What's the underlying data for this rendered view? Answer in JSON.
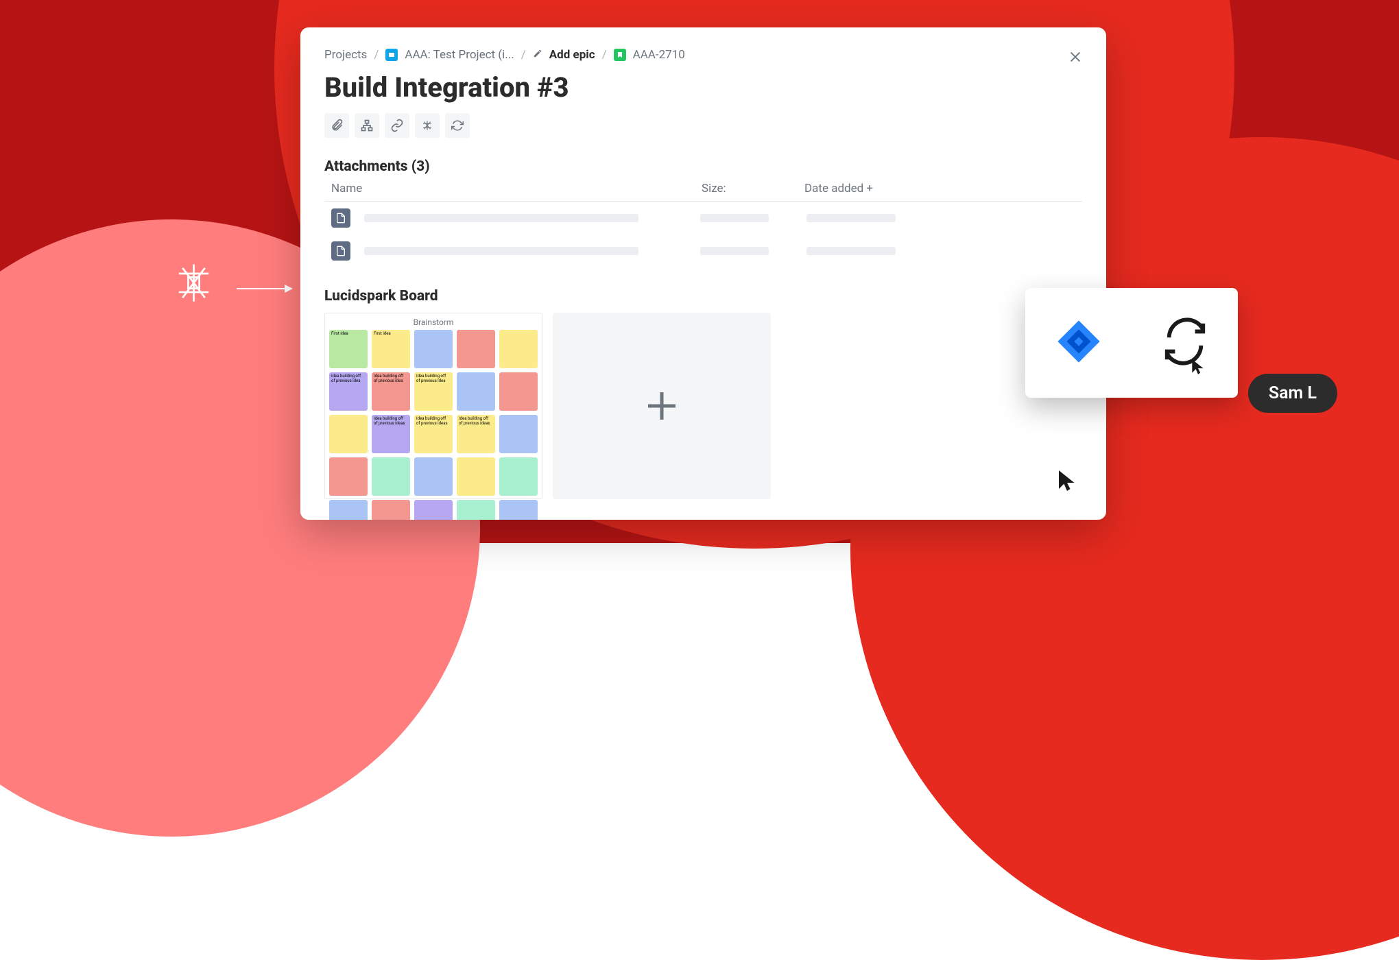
{
  "breadcrumb": {
    "projects": "Projects",
    "project_name": "AAA: Test Project (i...",
    "add_epic": "Add epic",
    "ticket": "AAA-2710"
  },
  "issue": {
    "title": "Build Integration #3"
  },
  "attachments": {
    "heading": "Attachments (3)",
    "columns": {
      "name": "Name",
      "size": "Size:",
      "date": "Date added +"
    }
  },
  "lucidspark": {
    "heading": "Lucidspark Board",
    "board_title": "Brainstorm",
    "stickies": [
      {
        "text": "First idea",
        "color": "#b9e8a3"
      },
      {
        "text": "First idea",
        "color": "#fceb8a"
      },
      {
        "text": "",
        "color": "#a9c4f5"
      },
      {
        "text": "",
        "color": "#f29891"
      },
      {
        "text": "",
        "color": "#fceb8a"
      },
      {
        "text": "Idea building off of previous idea",
        "color": "#b5a8f0"
      },
      {
        "text": "Idea building off of previous idea",
        "color": "#f29891"
      },
      {
        "text": "Idea building off of previous idea",
        "color": "#fceb8a"
      },
      {
        "text": "",
        "color": "#a9c4f5"
      },
      {
        "text": "",
        "color": "#f29891"
      },
      {
        "text": "",
        "color": "#fceb8a"
      },
      {
        "text": "Idea building off of previous ideas",
        "color": "#b5a8f0"
      },
      {
        "text": "Idea building off of previous ideas",
        "color": "#fceb8a"
      },
      {
        "text": "Idea building off of previous ideas",
        "color": "#fceb8a"
      },
      {
        "text": "",
        "color": "#a9c4f5"
      },
      {
        "text": "",
        "color": "#f29891"
      },
      {
        "text": "",
        "color": "#a9f0d1"
      },
      {
        "text": "",
        "color": "#a9c4f5"
      },
      {
        "text": "",
        "color": "#fceb8a"
      },
      {
        "text": "",
        "color": "#a9f0d1"
      },
      {
        "text": "",
        "color": "#a9c4f5"
      },
      {
        "text": "",
        "color": "#f29891"
      },
      {
        "text": "",
        "color": "#b5a8f0"
      },
      {
        "text": "",
        "color": "#a9f0d1"
      },
      {
        "text": "",
        "color": "#a9c4f5"
      }
    ]
  },
  "collaborator": {
    "name": "Sam L"
  }
}
